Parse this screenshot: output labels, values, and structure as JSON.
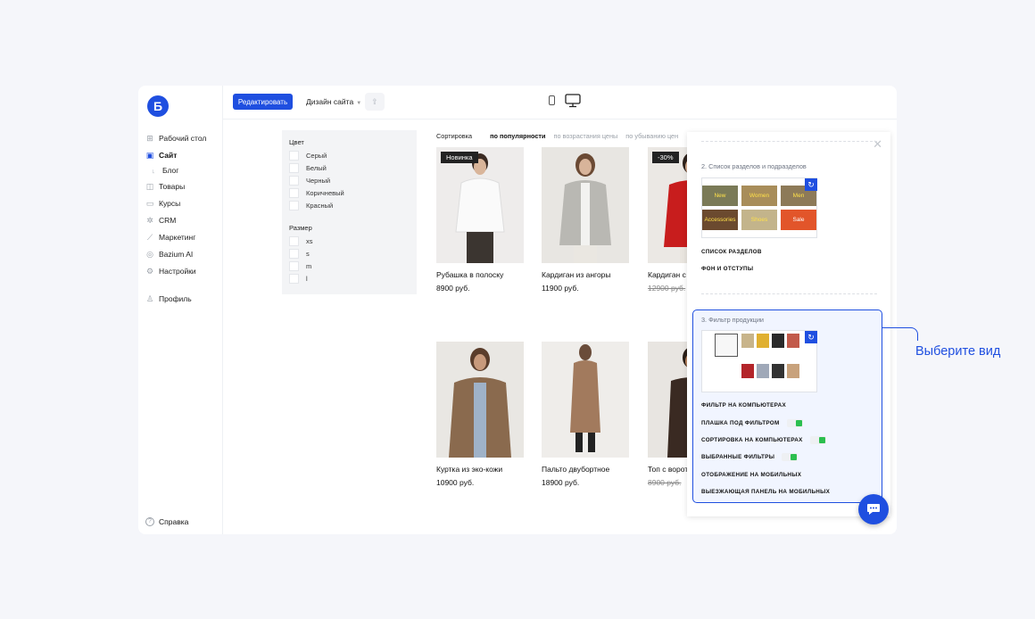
{
  "sidebar": {
    "logo": "Б",
    "items": [
      {
        "label": "Рабочий стол",
        "icon": "grid-icon"
      },
      {
        "label": "Сайт",
        "icon": "layout-icon",
        "active": true
      },
      {
        "label": "Блог",
        "icon": "sub-arrow-icon",
        "sub": true
      },
      {
        "label": "Товары",
        "icon": "bag-icon"
      },
      {
        "label": "Курсы",
        "icon": "book-icon"
      },
      {
        "label": "CRM",
        "icon": "crm-icon"
      },
      {
        "label": "Маркетинг",
        "icon": "chart-icon"
      },
      {
        "label": "Bazium AI",
        "icon": "ai-icon"
      },
      {
        "label": "Настройки",
        "icon": "gear-icon"
      }
    ],
    "profile": "Профиль",
    "help": "Справка"
  },
  "toolbar": {
    "edit_label": "Редактировать",
    "design_label": "Дизайн сайта"
  },
  "filters": {
    "color_title": "Цвет",
    "colors": [
      "Серый",
      "Белый",
      "Черный",
      "Коричневый",
      "Красный"
    ],
    "size_title": "Размер",
    "sizes": [
      "xs",
      "s",
      "m",
      "l"
    ]
  },
  "sort": {
    "label": "Сортировка",
    "options": [
      "по популярности",
      "по возрастания цены",
      "по убыванию цен"
    ],
    "active": "по популярности"
  },
  "products": [
    {
      "name": "Рубашка в полоску",
      "price": "8900 руб.",
      "badge": "Новинка"
    },
    {
      "name": "Кардиган из ангоры",
      "price": "11900 руб."
    },
    {
      "name": "Кардиган с воротником",
      "price": "12900 руб.",
      "badge": "-30%",
      "old": true
    },
    {
      "name": "Куртка из эко-кожи",
      "price": "10900 руб."
    },
    {
      "name": "Пальто двубортное",
      "price": "18900 руб."
    },
    {
      "name": "Топ с ворот",
      "price": "8900 руб.",
      "old": true
    }
  ],
  "panel": {
    "section2_title": "2. Список разделов и подразделов",
    "tiles": [
      "New",
      "Women",
      "Men",
      "Accessories",
      "Shoes",
      "Sale"
    ],
    "section2_options": [
      "СПИСОК РАЗДЕЛОВ",
      "ФОН И ОТСТУПЫ"
    ],
    "section3_title": "3. Фильтр продукции",
    "section3_options": [
      {
        "label": "ФИЛЬТР НА КОМПЬЮТЕРАХ"
      },
      {
        "label": "ПЛАШКА ПОД ФИЛЬТРОМ",
        "toggle": true
      },
      {
        "label": "СОРТИРОВКА НА КОМПЬЮТЕРАХ",
        "toggle": true
      },
      {
        "label": "ВЫБРАННЫЕ ФИЛЬТРЫ",
        "toggle": true
      },
      {
        "label": "ОТОБРАЖЕНИЕ НА МОБИЛЬНЫХ"
      },
      {
        "label": "ВЫЕЗЖАЮЩАЯ ПАНЕЛЬ НА МОБИЛЬНЫХ"
      }
    ]
  },
  "callout": "Выберите вид",
  "colors": {
    "accent": "#1f4fe0",
    "toggle_on": "#2cbf4f",
    "sale_tile": "#e2552a"
  }
}
